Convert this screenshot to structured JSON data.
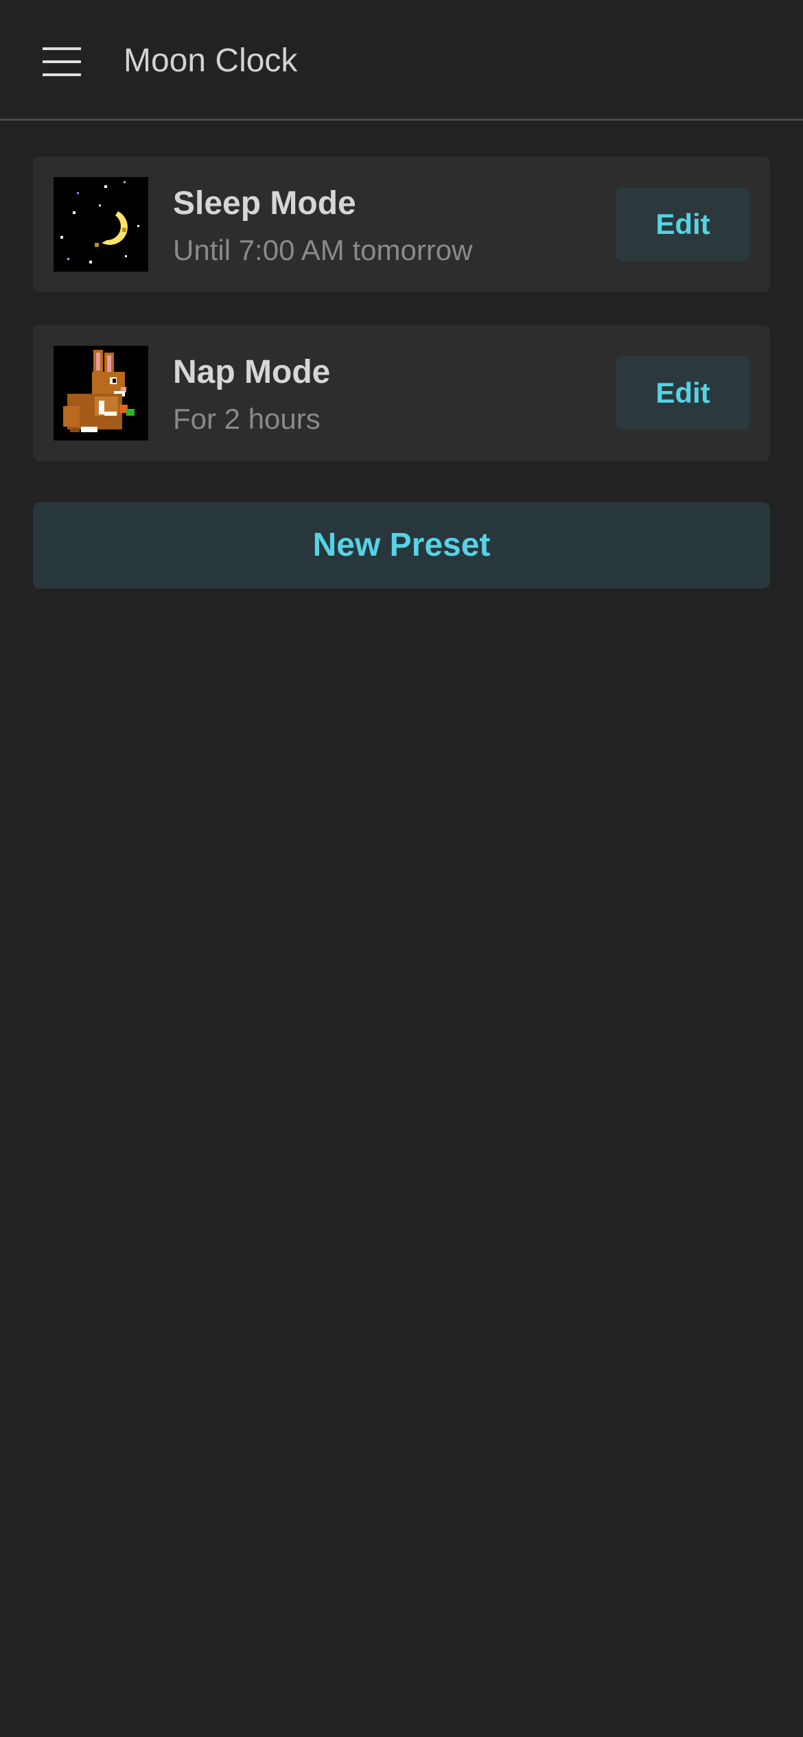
{
  "app_bar": {
    "menu_icon": "hamburger-menu-icon",
    "title": "Moon Clock"
  },
  "presets": [
    {
      "name": "Sleep Mode",
      "subtitle": "Until 7:00 AM tomorrow",
      "thumbnail": "crescent-moon-icon",
      "edit_label": "Edit"
    },
    {
      "name": "Nap Mode",
      "subtitle": "For 2 hours",
      "thumbnail": "bunny-icon",
      "edit_label": "Edit"
    }
  ],
  "new_preset_label": "New Preset",
  "colors": {
    "background": "#222222",
    "card": "#2d2d2d",
    "accent": "#56d3e5",
    "button_bg": "#2b393d",
    "title_text": "#d6d6d6",
    "secondary_text": "#8a8a8a"
  }
}
